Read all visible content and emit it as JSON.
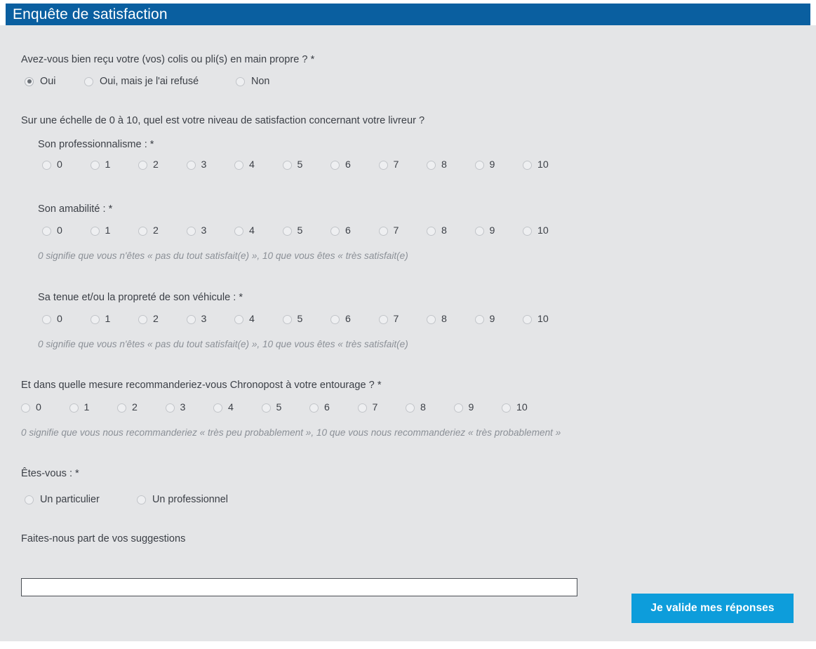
{
  "header": {
    "title": "Enquête de satisfaction",
    "bar_color": "#0a5fa0"
  },
  "panel": {
    "background_color": "#e4e5e7"
  },
  "questions": {
    "delivery": {
      "label": "Avez-vous bien reçu votre (vos) colis ou pli(s) en main propre ? *",
      "options": [
        {
          "label": "Oui",
          "checked": true
        },
        {
          "label": "Oui, mais je l'ai refusé",
          "checked": false
        },
        {
          "label": "Non",
          "checked": false
        }
      ]
    },
    "satisfaction_intro": "Sur une échelle de 0 à 10, quel est votre niveau de satisfaction concernant votre livreur ?",
    "scale_values": [
      "0",
      "1",
      "2",
      "3",
      "4",
      "5",
      "6",
      "7",
      "8",
      "9",
      "10"
    ],
    "subquestions": [
      {
        "label": "Son professionnalisme : *",
        "hint": ""
      },
      {
        "label": "Son amabilité : *",
        "hint": "0 signifie que vous n'êtes « pas du tout satisfait(e) », 10 que vous êtes « très satisfait(e)"
      },
      {
        "label": "Sa tenue et/ou la propreté de son véhicule : *",
        "hint": "0 signifie que vous n'êtes « pas du tout satisfait(e) », 10 que vous êtes « très satisfait(e)"
      }
    ],
    "recommendation": {
      "label": "Et dans quelle mesure recommanderiez-vous Chronopost à votre entourage ? *",
      "hint": "0 signifie que vous nous recommanderiez « très peu probablement », 10 que vous nous recommanderiez « très probablement »"
    },
    "profile": {
      "label": "Êtes-vous : *",
      "options": [
        {
          "label": "Un particulier",
          "checked": false
        },
        {
          "label": "Un professionnel",
          "checked": false
        }
      ]
    },
    "suggestions": {
      "label": "Faites-nous part de vos suggestions",
      "value": "",
      "placeholder": ""
    }
  },
  "submit": {
    "label": "Je valide mes réponses",
    "color": "#0d9ddb"
  }
}
